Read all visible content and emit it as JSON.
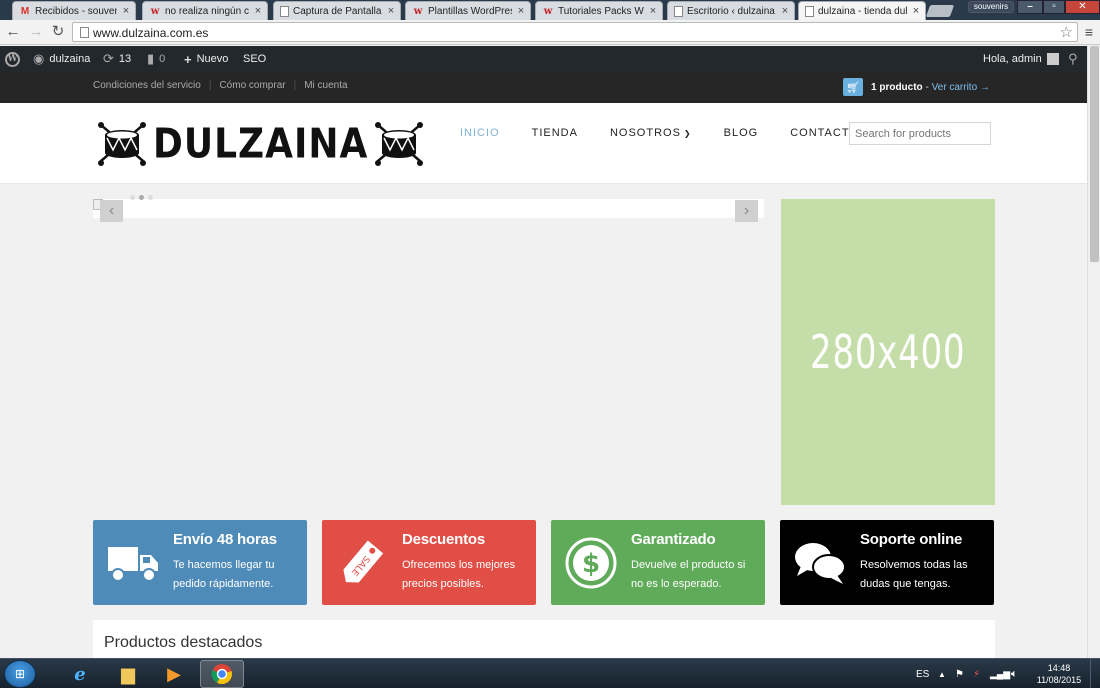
{
  "browser": {
    "tabs": [
      {
        "title": "Recibidos - souvenirs",
        "favicon": "gmail-icon"
      },
      {
        "title": "no realiza ningún cam",
        "favicon": "w-icon"
      },
      {
        "title": "Captura de Pantalla - ",
        "favicon": "page-icon"
      },
      {
        "title": "Plantillas WordPress - ",
        "favicon": "w-icon"
      },
      {
        "title": "Tutoriales Packs Webs",
        "favicon": "w-icon"
      },
      {
        "title": "Escritorio ‹ dulzaina —",
        "favicon": "page-icon"
      },
      {
        "title": "dulzaina - tienda dulz",
        "favicon": "page-icon",
        "active": true
      }
    ],
    "profile": "souvenirs",
    "url": "www.dulzaina.com.es"
  },
  "adminbar": {
    "site_name": "dulzaina",
    "updates": "13",
    "comments": "0",
    "new_label": "Nuevo",
    "seo_label": "SEO",
    "greeting": "Hola, admin"
  },
  "topbar": {
    "links": [
      "Condiciones del servicio",
      "Cómo comprar",
      "Mi cuenta"
    ],
    "cart_count": "1 producto",
    "cart_sep": " - ",
    "cart_link": "Ver carrito →"
  },
  "header": {
    "logo_text": "DULZAINA",
    "nav": [
      "INICIO",
      "TIENDA",
      "NOSOTROS",
      "BLOG",
      "CONTACTO"
    ],
    "active_nav": "INICIO",
    "search_placeholder": "Search for products"
  },
  "sidebar_ad": {
    "text": "280x400",
    "color": "#c5dea9"
  },
  "features": [
    {
      "title": "Envío 48 horas",
      "desc": "Te hacemos llegar tu pedido rápidamente.",
      "icon": "truck-icon",
      "color": "#4f8bb8"
    },
    {
      "title": "Descuentos",
      "desc": "Ofrecemos los mejores precios posibles.",
      "icon": "sale-tag-icon",
      "color": "#e04e45"
    },
    {
      "title": "Garantizado",
      "desc": "Devuelve el producto si no es lo esperado.",
      "icon": "dollar-icon",
      "color": "#5fab59"
    },
    {
      "title": "Soporte online",
      "desc": "Resolvemos todas las dudas que tengas.",
      "icon": "chat-bubbles-icon",
      "color": "#000000"
    }
  ],
  "products": {
    "title": "Productos destacados"
  },
  "taskbar": {
    "lang": "ES",
    "time": "14:48",
    "date": "11/08/2015"
  }
}
